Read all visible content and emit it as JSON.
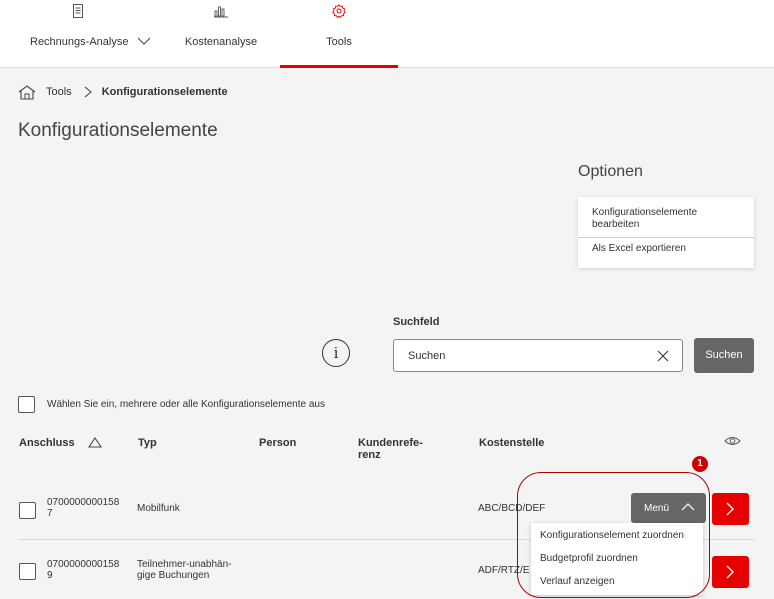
{
  "nav": {
    "tabs": [
      {
        "label": "Rechnungs-Analyse",
        "icon": "document-icon"
      },
      {
        "label": "Kostenanalyse",
        "icon": "bar-chart-icon"
      },
      {
        "label": "Tools",
        "icon": "gear-icon",
        "active": true
      }
    ]
  },
  "breadcrumb": {
    "items": [
      "Tools",
      "Konfigurationselemente"
    ]
  },
  "page": {
    "title": "Konfigurationselemente"
  },
  "options": {
    "title": "Optionen",
    "items": [
      "Konfigurationselemente bearbeiten",
      "Als Excel exportieren"
    ]
  },
  "search": {
    "label": "Suchfeld",
    "placeholder": "Suchen",
    "button": "Suchen"
  },
  "select_all": {
    "label": "Wählen Sie ein, mehrere oder alle Konfigurationselemente aus"
  },
  "table": {
    "headers": [
      "Anschluss",
      "Typ",
      "Person",
      "Kundenrefe-\nrenz",
      "Kostenstelle"
    ],
    "rows": [
      {
        "anschluss": "0700000000158\n7",
        "typ": "Mobilfunk",
        "person": "",
        "kundenreferenz": "",
        "kostenstelle": "ABC/BCD/DEF"
      },
      {
        "anschluss": "0700000000158\n9",
        "typ": "Teilnehmer-unabhän-\ngige Buchungen",
        "person": "",
        "kundenreferenz": "",
        "kostenstelle": "ADF/RTZ/E"
      }
    ],
    "menu_label": "Menü"
  },
  "row_menu": {
    "items": [
      "Konfigurationselement zuordnen",
      "Budgetprofil zuordnen",
      "Verlauf anzeigen"
    ]
  },
  "annotation": {
    "badge": "1"
  },
  "colors": {
    "accent": "#e60000",
    "button_gray": "#666666",
    "background": "#f4f4f4",
    "highlight": "#b00000"
  }
}
